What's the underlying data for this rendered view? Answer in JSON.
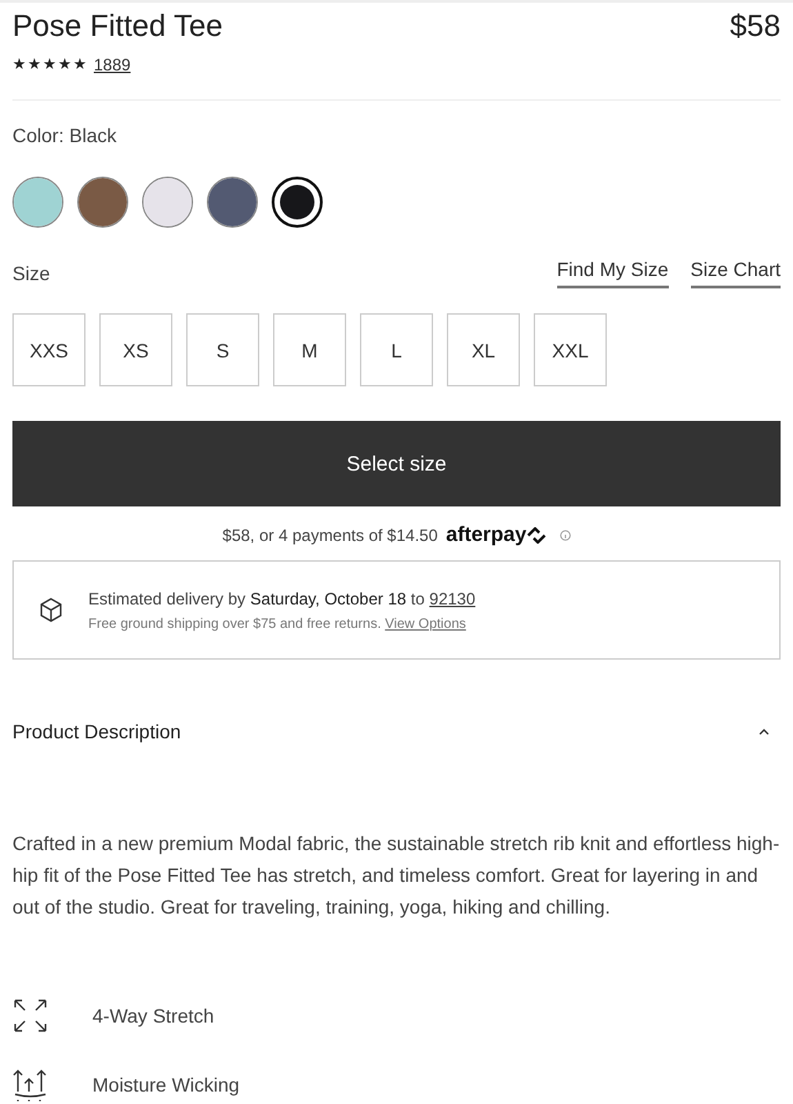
{
  "product": {
    "title": "Pose Fitted Tee",
    "price": "$58",
    "stars": 5,
    "review_count": "1889"
  },
  "color": {
    "label": "Color:",
    "value": "Black"
  },
  "swatches": [
    {
      "color": "#9fd3d3",
      "selected": false
    },
    {
      "color": "#7a5a45",
      "selected": false
    },
    {
      "color": "#e6e3ea",
      "selected": false
    },
    {
      "color": "#535a72",
      "selected": false
    },
    {
      "color": "#17171a",
      "selected": true
    }
  ],
  "size": {
    "label": "Size",
    "links": [
      "Find My Size",
      "Size Chart"
    ]
  },
  "sizes": [
    {
      "label": "XXS",
      "selected": false
    },
    {
      "label": "XS",
      "selected": false
    },
    {
      "label": "S",
      "selected": false
    },
    {
      "label": "M",
      "selected": false
    },
    {
      "label": "L",
      "selected": false
    },
    {
      "label": "XL",
      "selected": false
    },
    {
      "label": "XXL",
      "selected": false
    }
  ],
  "cta": "Select size",
  "afterpay": {
    "text": "$58, or 4 payments of $14.50",
    "brand": "afterpay"
  },
  "delivery": {
    "prefix": "Estimated delivery by",
    "date": "Saturday, October 18",
    "to": "to",
    "zip": "92130",
    "note": "Free ground shipping over $75 and free returns.",
    "link": "View Options"
  },
  "description": {
    "title": "Product Description",
    "expanded": true,
    "text": "Crafted in a new premium Modal fabric, the sustainable stretch rib knit and effortless high-hip fit of the Pose Fitted Tee has stretch, and timeless comfort. Great for layering in and out of the studio. Great for traveling, training, yoga, hiking and chilling."
  },
  "features": [
    {
      "kind": "stretch",
      "label": "4-Way Stretch"
    },
    {
      "kind": "wicking",
      "label": "Moisture Wicking"
    }
  ]
}
